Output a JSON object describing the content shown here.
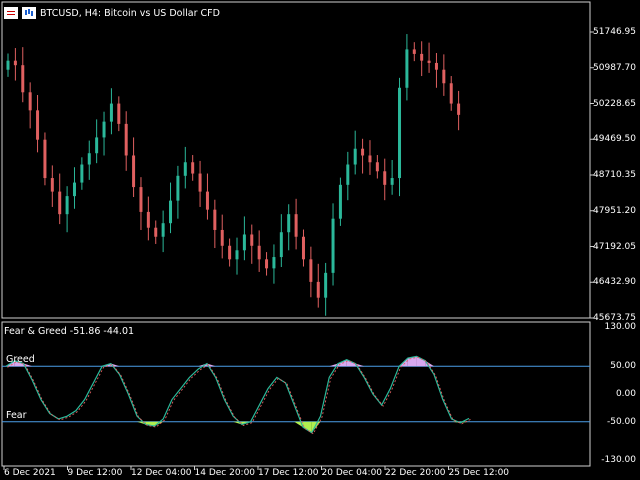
{
  "header": {
    "title": "BTCUSD, H4:  Bitcoin vs US Dollar CFD",
    "icons": [
      "list-icon",
      "bars-icon"
    ]
  },
  "indicator": {
    "label": "Fear & Greed -51.86 -44.01",
    "greed_label": "Greed",
    "fear_label": "Fear",
    "greed_level": 50,
    "fear_level": -50
  },
  "price_axis": [
    "51746.95",
    "50987.70",
    "50228.65",
    "49469.50",
    "48710.35",
    "47951.20",
    "47192.05",
    "46432.90",
    "45673.75"
  ],
  "indicator_axis": [
    "130.00",
    "50.00",
    "0.00",
    "-50.00",
    "-130.00"
  ],
  "time_axis": [
    "6 Dec 2021",
    "9 Dec 12:00",
    "12 Dec 04:00",
    "14 Dec 20:00",
    "17 Dec 12:00",
    "20 Dec 04:00",
    "22 Dec 20:00",
    "25 Dec 12:00"
  ],
  "colors": {
    "background": "#000000",
    "bull": "#2bb89a",
    "bear": "#e06060",
    "grid": "#3a3a3a",
    "level_line": "#4a9ee8",
    "greed_fill": "#d8a8f0",
    "fear_fill": "#b0f050"
  },
  "chart_data": [
    {
      "type": "candlestick",
      "series": [
        {
          "name": "BTCUSD",
          "close": [
            51000,
            50900,
            50300,
            49900,
            49250,
            48400,
            48100,
            47600,
            48000,
            48300,
            48700,
            48950,
            49300,
            49650,
            50050,
            49600,
            48900,
            48200,
            47650,
            47300,
            47100,
            47400,
            47900,
            48450,
            48750,
            48500,
            48100,
            47700,
            47250,
            46900,
            46600,
            46800,
            47150,
            46900,
            46600,
            46400,
            46650,
            47200,
            47600,
            47100,
            46600,
            46100,
            45750,
            46300,
            47500,
            48250,
            48700,
            49050,
            48900,
            48750,
            48550,
            48250,
            48400,
            50400,
            51250,
            51150,
            51000,
            50950,
            50800,
            50500,
            50050,
            49800
          ]
        }
      ],
      "ylim": [
        45300,
        52300
      ]
    },
    {
      "type": "line",
      "series": [
        {
          "name": "Fear & Greed",
          "values": [
            50,
            60,
            55,
            25,
            -10,
            -35,
            -45,
            -40,
            -30,
            -10,
            20,
            50,
            55,
            35,
            0,
            -40,
            -55,
            -58,
            -45,
            -10,
            10,
            30,
            45,
            55,
            30,
            -10,
            -40,
            -55,
            -50,
            -20,
            10,
            30,
            20,
            -20,
            -60,
            -70,
            -40,
            30,
            55,
            62,
            55,
            30,
            0,
            -20,
            10,
            50,
            65,
            68,
            60,
            35,
            -10,
            -45,
            -52,
            -44
          ]
        }
      ],
      "ylim": [
        -130,
        130
      ]
    }
  ]
}
